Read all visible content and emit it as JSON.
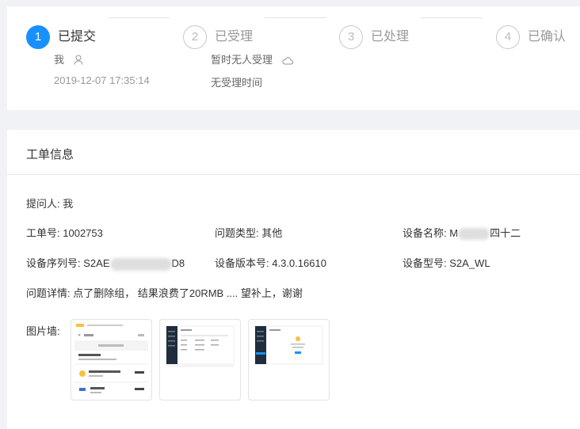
{
  "steps": [
    {
      "number": "1",
      "title": "已提交",
      "person": "我",
      "time": "2019-12-07 17:35:14",
      "person_icon": "user-icon"
    },
    {
      "number": "2",
      "title": "已受理",
      "person": "暂时无人受理",
      "time": "无受理时间",
      "person_icon": "cloud-icon"
    },
    {
      "number": "3",
      "title": "已处理"
    },
    {
      "number": "4",
      "title": "已确认"
    }
  ],
  "colors": {
    "accent": "#1890ff",
    "inactive": "#bbbbbb"
  },
  "info": {
    "title": "工单信息",
    "asker_label": "提问人:",
    "asker_value": "我",
    "ticket_label": "工单号:",
    "ticket_value": "1002753",
    "issue_type_label": "问题类型:",
    "issue_type_value": "其他",
    "device_name_label": "设备名称:",
    "device_name_prefix": "M",
    "device_name_suffix": "四十二",
    "serial_label": "设备序列号:",
    "serial_prefix": "S2AE",
    "serial_suffix": "D8",
    "version_label": "设备版本号:",
    "version_value": "4.3.0.16610",
    "model_label": "设备型号:",
    "model_value": "S2A_WL",
    "detail_label": "问题详情:",
    "detail_value": "点了删除组， 结果浪费了20RMB .... 望补上，谢谢",
    "pics_label": "图片墙:"
  },
  "thumbnails": [
    {
      "name": "mobile-app-screenshot"
    },
    {
      "name": "web-table-screenshot"
    },
    {
      "name": "web-dialog-screenshot"
    }
  ]
}
